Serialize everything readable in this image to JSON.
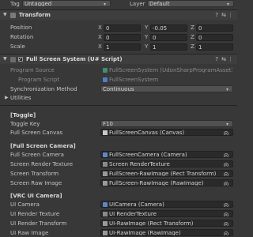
{
  "top": {
    "tag_label": "Tag",
    "tag_value": "Untagged",
    "layer_label": "Layer",
    "layer_value": "Default"
  },
  "transform": {
    "title": "Transform",
    "rows": [
      {
        "label": "Position",
        "x": "0",
        "y": "-0.05",
        "z": "0"
      },
      {
        "label": "Rotation",
        "x": "0",
        "y": "0",
        "z": "0"
      },
      {
        "label": "Scale",
        "x": "1",
        "y": "1",
        "z": "1"
      }
    ],
    "axis": {
      "x": "X",
      "y": "Y",
      "z": "Z"
    }
  },
  "component": {
    "title": "Full Screen System (U# Script)",
    "program_source_label": "Program Source",
    "program_source_value": "FullScreenSystem (UdonSharpProgramAsset)",
    "program_script_label": "Program Script",
    "program_script_value": "FullScreenSystem",
    "sync_label": "Synchronization Method",
    "sync_value": "Continuous",
    "utilities_label": "Utilities"
  },
  "sections": {
    "toggle_title": "[Toggle]",
    "toggle_key_label": "Toggle Key",
    "toggle_key_value": "F10",
    "fs_canvas_label": "Full Screen Canvas",
    "fs_canvas_value": "FullScreenCanvas (Canvas)",
    "fs_camera_title": "[Full Screen Camera]",
    "fs_camera_label": "Full Screen Camera",
    "fs_camera_value": "FullScreenCamera (Camera)",
    "screen_rt_label": "Screen Render Texture",
    "screen_rt_value": "Screen RenderTexture",
    "screen_tf_label": "Screen Transform",
    "screen_tf_value": "FullScreen-RawImage (Rect Transform)",
    "screen_raw_label": "Screen Raw Image",
    "screen_raw_value": "FullScreen-RawImage (RawImage)",
    "vrc_title": "[VRC UI Camera]",
    "ui_camera_label": "UI Camera",
    "ui_camera_value": "UICamera (Camera)",
    "ui_rt_label": "UI Render Texture",
    "ui_rt_value": "UI RenderTexture",
    "ui_rtf_label": "UI Render Transform",
    "ui_rtf_value": "UI-RawImage (Rect Transform)",
    "ui_raw_label": "UI Raw Image",
    "ui_raw_value": "UI-RawImage (RawImage)"
  },
  "icons": {
    "question": "?",
    "settings": "⇆",
    "more": "⋮",
    "dropdown": "▾",
    "foldout_open": "▼",
    "foldout_closed": "▶"
  }
}
